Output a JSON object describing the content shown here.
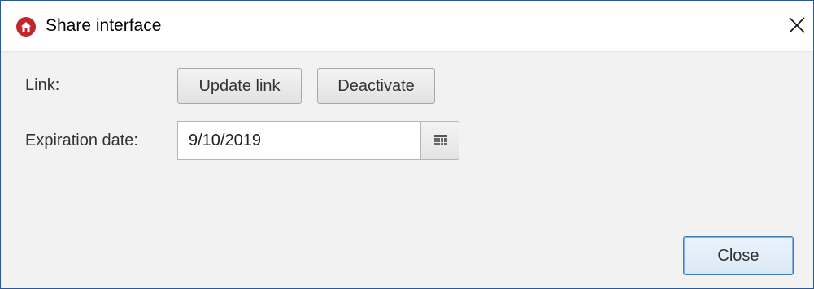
{
  "window": {
    "title": "Share interface",
    "app_icon": "home-icon",
    "close_icon": "close-icon"
  },
  "form": {
    "link_label": "Link:",
    "update_link_label": "Update link",
    "deactivate_label": "Deactivate",
    "expiration_label": "Expiration date:",
    "expiration_value": "9/10/2019",
    "calendar_icon": "calendar-icon"
  },
  "footer": {
    "close_label": "Close"
  },
  "colors": {
    "accent": "#c0272d",
    "default_button_border": "#3c7fb1",
    "background": "#f2f2f2"
  }
}
